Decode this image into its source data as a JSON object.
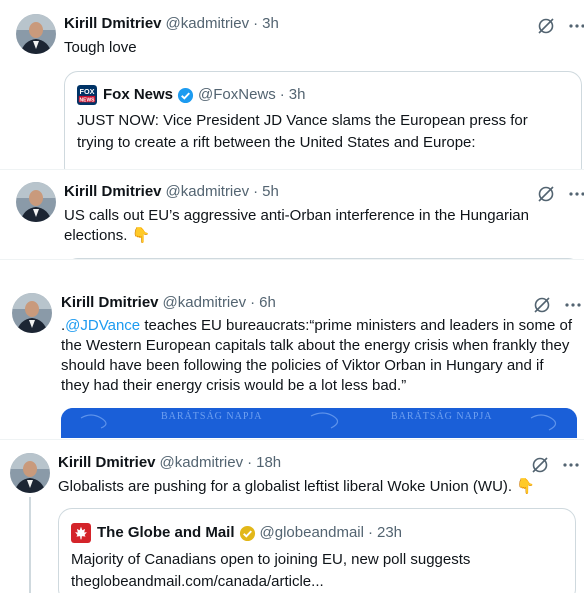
{
  "tweets": [
    {
      "author": "Kirill Dmitriev",
      "handle": "@kadmitriev",
      "time": "3h",
      "text": "Tough love",
      "quote": {
        "source": "Fox News",
        "handle": "@FoxNews",
        "time": "3h",
        "text": "JUST NOW: Vice President JD Vance slams the European press for trying to create a rift between the United States and Europe:"
      }
    },
    {
      "author": "Kirill Dmitriev",
      "handle": "@kadmitriev",
      "time": "5h",
      "text": "US calls out EU’s aggressive anti-Orban interference in the Hungarian elections.",
      "emoji": "👇"
    },
    {
      "author": "Kirill Dmitriev",
      "handle": "@kadmitriev",
      "time": "6h",
      "mention": "@JDVance",
      "text": "teaches EU bureaucrats:“prime ministers and leaders in some of the Western European capitals talk about the energy crisis when frankly they should have been following the policies of Viktor Orban in Hungary and if they had their energy crisis  would be a lot less bad.”",
      "leading_dot": ".",
      "media_banner": [
        "BARÁTSÁG NAPJA",
        "BARÁTSÁG NAPJA"
      ]
    },
    {
      "author": "Kirill Dmitriev",
      "handle": "@kadmitriev",
      "time": "18h",
      "text": "Globalists are pushing for a globalist leftist liberal Woke Union (WU).",
      "emoji": "👇",
      "quote": {
        "source": "The Globe and Mail",
        "handle": "@globeandmail",
        "time": "23h",
        "text": "Majority of Canadians open to joining EU, new poll suggests",
        "link": "theglobeandmail.com/canada/article..."
      }
    }
  ],
  "separator": "·",
  "icons": [
    "grok-icon",
    "more-icon",
    "verified-badge",
    "affiliate-badge"
  ],
  "colors": {
    "link": "#1d9bf0",
    "muted": "#536471",
    "border": "#cfd9de",
    "verified_blue": "#1d9bf0",
    "verified_gold": "#e2b719",
    "banner_blue": "#1a5fd8",
    "globe_red": "#d4242a"
  }
}
